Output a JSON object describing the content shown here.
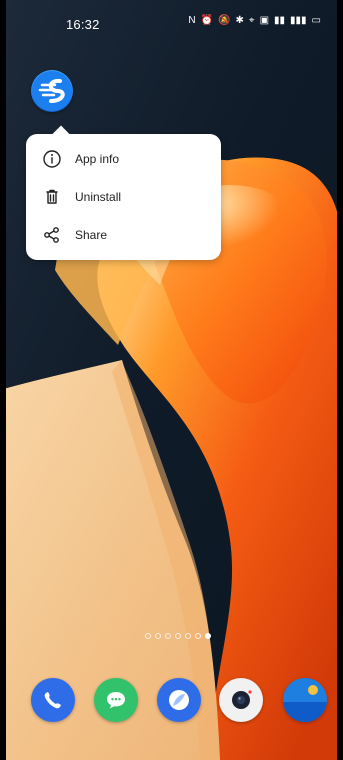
{
  "status_bar": {
    "time": "16:32",
    "icons": [
      "nfc-icon",
      "alarm-icon",
      "mute-icon",
      "bluetooth-icon",
      "location-icon",
      "hd-icon",
      "signal-icon",
      "signal-icon",
      "battery-icon"
    ]
  },
  "app_shortcut_menu": {
    "items": [
      {
        "label": "App info",
        "icon": "info-icon"
      },
      {
        "label": "Uninstall",
        "icon": "trash-icon"
      },
      {
        "label": "Share",
        "icon": "share-icon"
      }
    ]
  },
  "page_indicator": {
    "count": 7,
    "active_index": 6
  },
  "dock": {
    "apps": [
      {
        "icon": "phone-icon",
        "color": "#2f6de8"
      },
      {
        "icon": "messages-icon",
        "color": "#31c26b"
      },
      {
        "icon": "browser-icon",
        "color": "#2f6de8"
      },
      {
        "icon": "camera-icon",
        "color": "#f1f1f1"
      },
      {
        "icon": "weather-icon",
        "color": "#1f7fe0"
      }
    ]
  },
  "colors": {
    "accent_orange": "#f47b1f",
    "wallpaper_dark": "#0d1d2c",
    "peach": "#f3c68f",
    "menu_bg": "#ffffff"
  }
}
